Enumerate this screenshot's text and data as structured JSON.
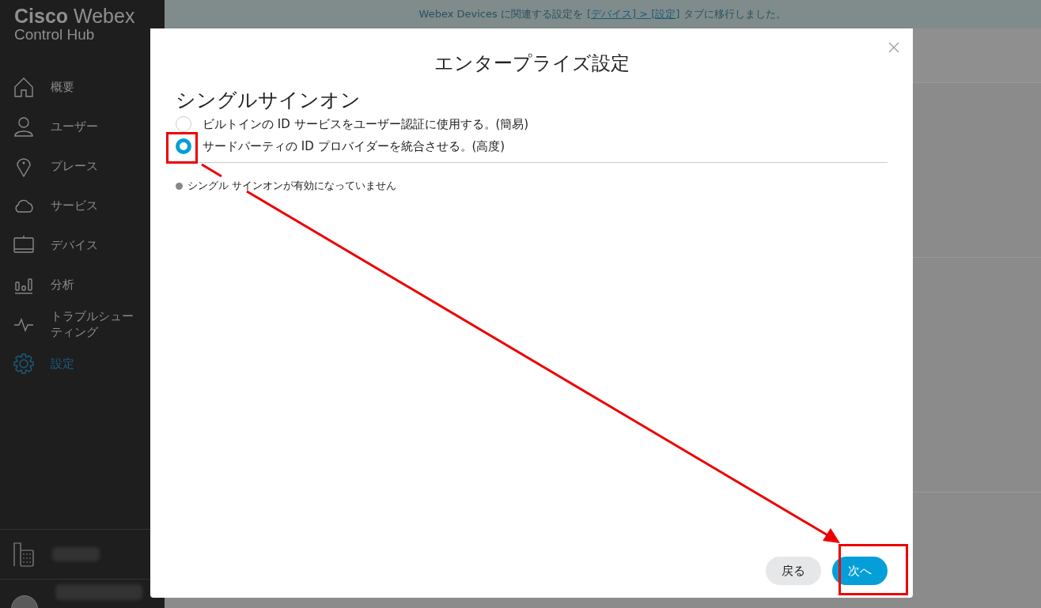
{
  "sidebar": {
    "brand_bold": "Cisco",
    "brand_light": "Webex",
    "product": "Control Hub",
    "items": [
      {
        "label": "概要",
        "selected": false
      },
      {
        "label": "ユーザー",
        "selected": false
      },
      {
        "label": "プレース",
        "selected": false
      },
      {
        "label": "サービス",
        "selected": false
      },
      {
        "label": "デバイス",
        "selected": false
      },
      {
        "label": "分析",
        "selected": false
      },
      {
        "label": "トラブルシューティング",
        "selected": false
      },
      {
        "label": "設定",
        "selected": true
      }
    ]
  },
  "banner": {
    "text_before": "Webex Devices に関連する設定を",
    "link": "[デバイス] > [設定]",
    "text_after": "タブに移行しました。"
  },
  "dialog": {
    "title": "エンタープライズ設定",
    "heading": "シングルサインオン",
    "options": [
      {
        "label": "ビルトインの ID サービスをユーザー認証に使用する。(簡易)",
        "selected": false
      },
      {
        "label": "サードパーティの ID プロバイダーを統合させる。(高度)",
        "selected": true
      }
    ],
    "status": "シングル サインオンが有効になっていません",
    "buttons": [
      {
        "label": "戻る",
        "kind": "secondary"
      },
      {
        "label": "次へ",
        "kind": "primary"
      }
    ]
  }
}
